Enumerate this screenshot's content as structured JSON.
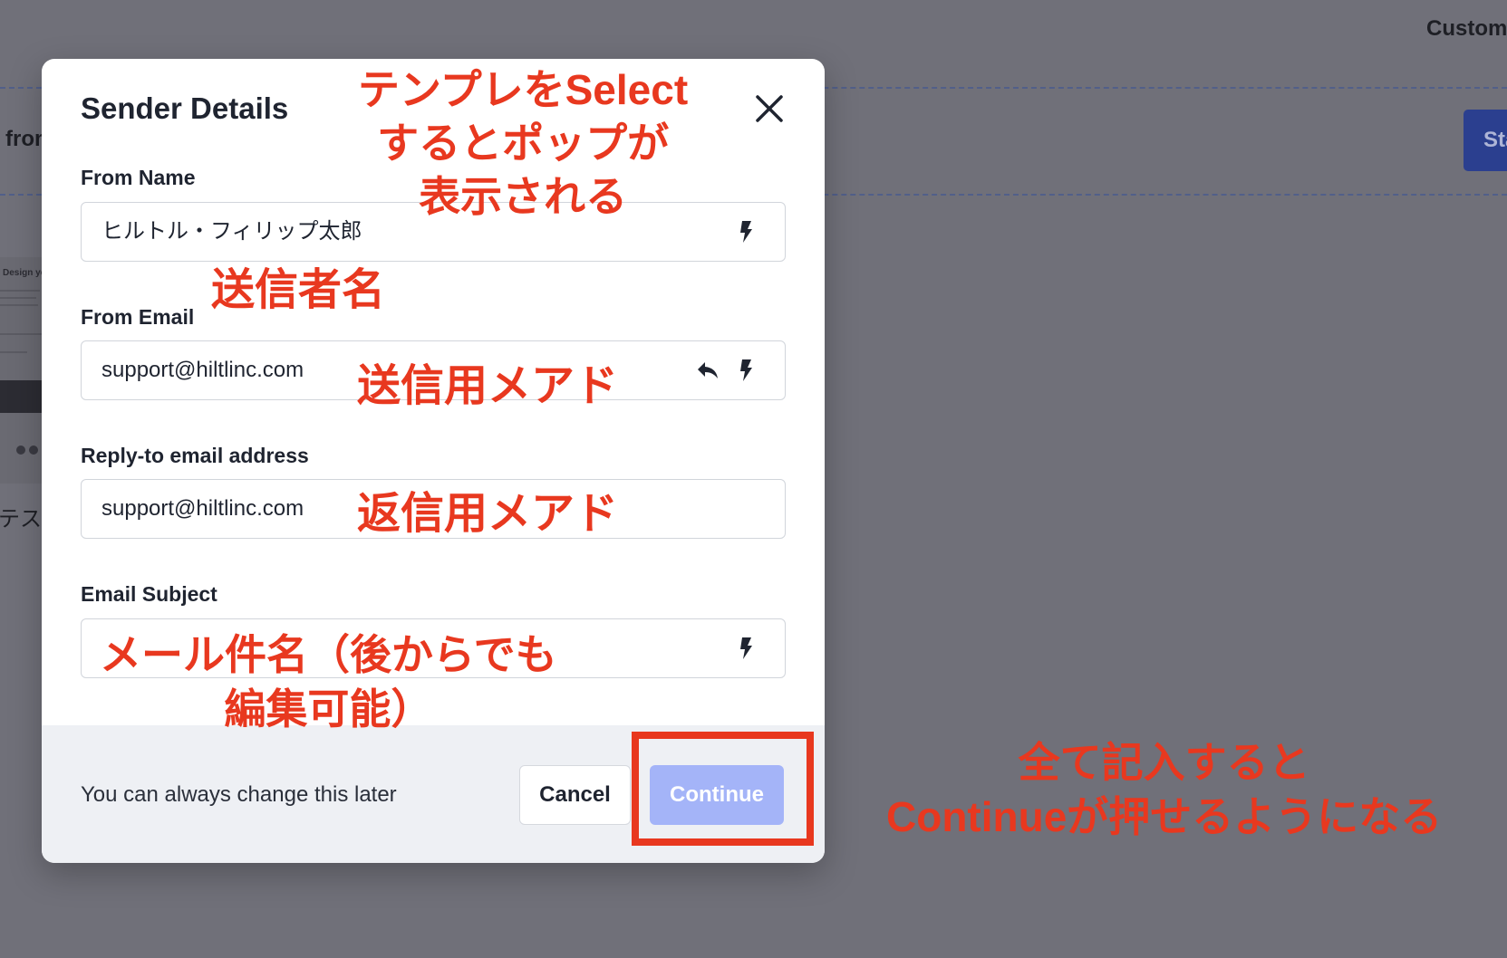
{
  "background": {
    "header_text": "Custom",
    "left_text": "from",
    "start_button_label": "Sta",
    "thumbnail_title": "Design yo",
    "bottom_text": "テス"
  },
  "modal": {
    "title": "Sender Details",
    "fields": {
      "from_name": {
        "label": "From Name",
        "value": "ヒルトル・フィリップ太郎"
      },
      "from_email": {
        "label": "From Email",
        "value": "support@hiltlinc.com"
      },
      "reply_to": {
        "label": "Reply-to email address",
        "value": "support@hiltlinc.com"
      },
      "subject": {
        "label": "Email Subject",
        "value": ""
      }
    },
    "footer": {
      "hint": "You can always change this later",
      "cancel_label": "Cancel",
      "continue_label": "Continue"
    }
  },
  "annotations": {
    "popup_note": [
      "テンプレをSelect",
      "するとポップが",
      "表示される"
    ],
    "from_name_note": "送信者名",
    "from_email_note": "送信用メアド",
    "reply_to_note": "返信用メアド",
    "subject_note": [
      "メール件名（後からでも",
      "編集可能）"
    ],
    "continue_note": [
      "全て記入すると",
      "Continueが押せるようになる"
    ]
  },
  "colors": {
    "annotation_red": "#e8381f",
    "continue_disabled": "#a4b4f8",
    "footer_bg": "#eef0f4",
    "overlay": "#707079"
  }
}
